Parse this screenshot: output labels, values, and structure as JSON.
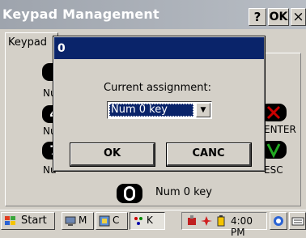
{
  "window": {
    "title": "Keypad Management",
    "help_label": "?",
    "ok_label": "OK",
    "close_label": "×"
  },
  "tab": {
    "label": "Keypad"
  },
  "background_keys": {
    "row_labels": [
      "Nu",
      "Nu",
      "Nu"
    ],
    "right_labels": [
      "ENTER",
      "ESC"
    ],
    "key4_glyph": "4",
    "key7_glyph": "7",
    "bottom_key_label": "Num 0 key"
  },
  "dialog": {
    "title": "0",
    "prompt": "Current assignment:",
    "selected_value": "Num 0 key",
    "ok_label": "OK",
    "cancel_label": "CANC"
  },
  "taskbar": {
    "start_label": "Start",
    "tasks": [
      "M",
      "C",
      "K"
    ],
    "clock": "4:00 PM"
  },
  "colors": {
    "dialog_title_bg": "#0a246a",
    "window_title_bg": "#9ea4ad",
    "enter_icon": "#cc0000",
    "esc_icon": "#22aa22"
  }
}
